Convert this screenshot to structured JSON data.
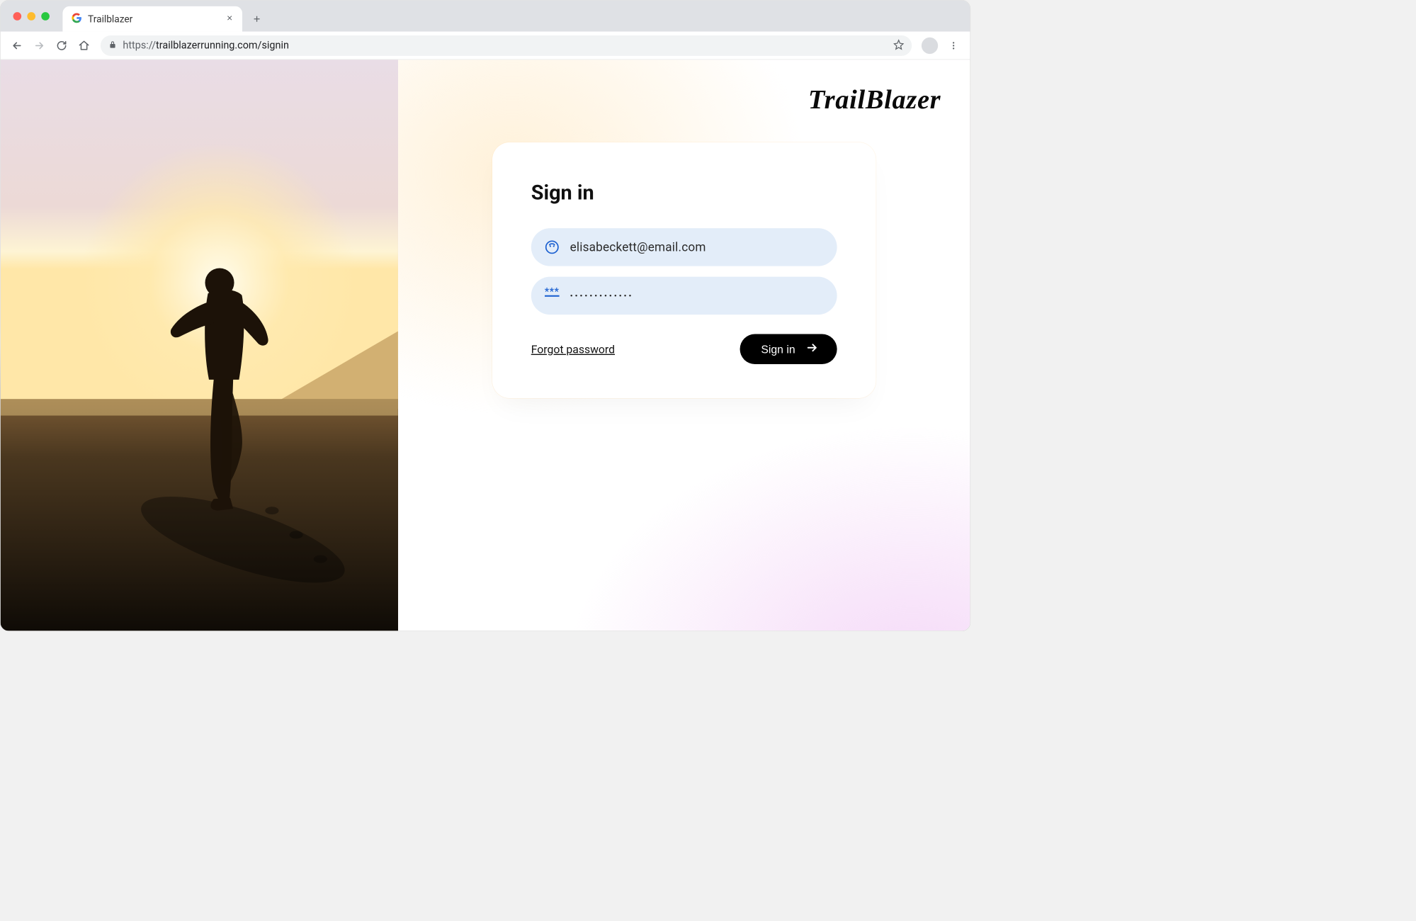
{
  "browser": {
    "tab_title": "Trailblazer",
    "url_scheme": "https://",
    "url_rest": "trailblazerrunning.com/signin"
  },
  "brand": "TrailBlazer",
  "signin": {
    "heading": "Sign in",
    "email_value": "elisabeckett@email.com",
    "password_value": "•••••••••••••",
    "forgot_label": "Forgot password",
    "submit_label": "Sign in"
  }
}
